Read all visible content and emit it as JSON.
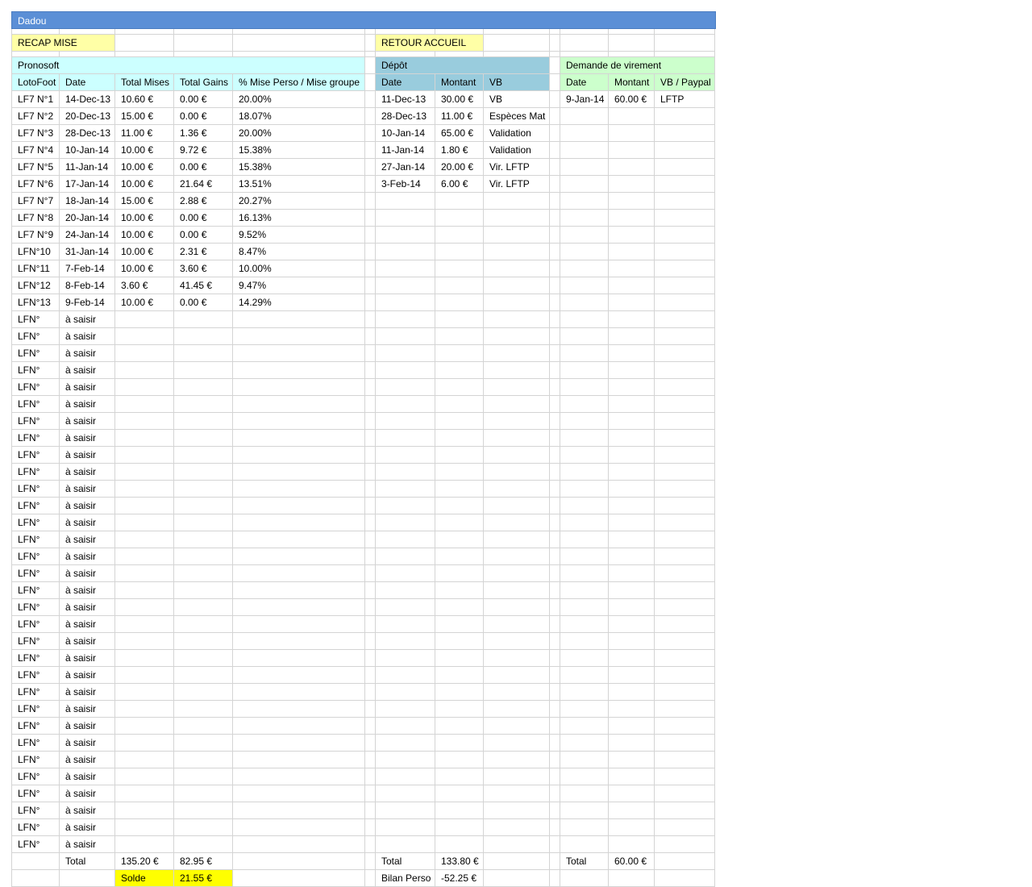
{
  "title": "Dadou",
  "links": {
    "recap": "RECAP MISE",
    "retour": "RETOUR ACCUEIL"
  },
  "pronosoft": {
    "title": "Pronosoft",
    "headers": [
      "LotoFoot",
      "Date",
      "Total Mises",
      "Total Gains",
      "% Mise Perso / Mise groupe"
    ],
    "rows": [
      [
        "LF7 N°1",
        "14-Dec-13",
        "10.60 €",
        "0.00 €",
        "20.00%"
      ],
      [
        "LF7 N°2",
        "20-Dec-13",
        "15.00 €",
        "0.00 €",
        "18.07%"
      ],
      [
        "LF7 N°3",
        "28-Dec-13",
        "11.00 €",
        "1.36 €",
        "20.00%"
      ],
      [
        "LF7 N°4",
        "10-Jan-14",
        "10.00 €",
        "9.72 €",
        "15.38%"
      ],
      [
        "LF7 N°5",
        "11-Jan-14",
        "10.00 €",
        "0.00 €",
        "15.38%"
      ],
      [
        "LF7 N°6",
        "17-Jan-14",
        "10.00 €",
        "21.64 €",
        "13.51%"
      ],
      [
        "LF7 N°7",
        "18-Jan-14",
        "15.00 €",
        "2.88 €",
        "20.27%"
      ],
      [
        "LF7 N°8",
        "20-Jan-14",
        "10.00 €",
        "0.00 €",
        "16.13%"
      ],
      [
        "LF7 N°9",
        "24-Jan-14",
        "10.00 €",
        "0.00 €",
        "9.52%"
      ],
      [
        "LFN°10",
        "31-Jan-14",
        "10.00 €",
        "2.31 €",
        "8.47%"
      ],
      [
        "LFN°11",
        "7-Feb-14",
        "10.00 €",
        "3.60 €",
        "10.00%"
      ],
      [
        "LFN°12",
        "8-Feb-14",
        "3.60 €",
        "41.45 €",
        "9.47%"
      ],
      [
        "LFN°13",
        "9-Feb-14",
        "10.00 €",
        "0.00 €",
        "14.29%"
      ],
      [
        "LFN°",
        "à saisir",
        "",
        "",
        ""
      ],
      [
        "LFN°",
        "à saisir",
        "",
        "",
        ""
      ],
      [
        "LFN°",
        "à saisir",
        "",
        "",
        ""
      ],
      [
        "LFN°",
        "à saisir",
        "",
        "",
        ""
      ],
      [
        "LFN°",
        "à saisir",
        "",
        "",
        ""
      ],
      [
        "LFN°",
        "à saisir",
        "",
        "",
        ""
      ],
      [
        "LFN°",
        "à saisir",
        "",
        "",
        ""
      ],
      [
        "LFN°",
        "à saisir",
        "",
        "",
        ""
      ],
      [
        "LFN°",
        "à saisir",
        "",
        "",
        ""
      ],
      [
        "LFN°",
        "à saisir",
        "",
        "",
        ""
      ],
      [
        "LFN°",
        "à saisir",
        "",
        "",
        ""
      ],
      [
        "LFN°",
        "à saisir",
        "",
        "",
        ""
      ],
      [
        "LFN°",
        "à saisir",
        "",
        "",
        ""
      ],
      [
        "LFN°",
        "à saisir",
        "",
        "",
        ""
      ],
      [
        "LFN°",
        "à saisir",
        "",
        "",
        ""
      ],
      [
        "LFN°",
        "à saisir",
        "",
        "",
        ""
      ],
      [
        "LFN°",
        "à saisir",
        "",
        "",
        ""
      ],
      [
        "LFN°",
        "à saisir",
        "",
        "",
        ""
      ],
      [
        "LFN°",
        "à saisir",
        "",
        "",
        ""
      ],
      [
        "LFN°",
        "à saisir",
        "",
        "",
        ""
      ],
      [
        "LFN°",
        "à saisir",
        "",
        "",
        ""
      ],
      [
        "LFN°",
        "à saisir",
        "",
        "",
        ""
      ],
      [
        "LFN°",
        "à saisir",
        "",
        "",
        ""
      ],
      [
        "LFN°",
        "à saisir",
        "",
        "",
        ""
      ],
      [
        "LFN°",
        "à saisir",
        "",
        "",
        ""
      ],
      [
        "LFN°",
        "à saisir",
        "",
        "",
        ""
      ],
      [
        "LFN°",
        "à saisir",
        "",
        "",
        ""
      ],
      [
        "LFN°",
        "à saisir",
        "",
        "",
        ""
      ],
      [
        "LFN°",
        "à saisir",
        "",
        "",
        ""
      ],
      [
        "LFN°",
        "à saisir",
        "",
        "",
        ""
      ],
      [
        "LFN°",
        "à saisir",
        "",
        "",
        ""
      ],
      [
        "LFN°",
        "à saisir",
        "",
        "",
        ""
      ]
    ],
    "total_label": "Total",
    "total_mises": "135.20 €",
    "total_gains": "82.95 €",
    "solde_label": "Solde",
    "solde_value": "21.55 €"
  },
  "depot": {
    "title": "Dépôt",
    "headers": [
      "Date",
      "Montant",
      "VB"
    ],
    "rows": [
      [
        "11-Dec-13",
        "30.00 €",
        "VB"
      ],
      [
        "28-Dec-13",
        "11.00 €",
        "Espèces Mat"
      ],
      [
        "10-Jan-14",
        "65.00 €",
        "Validation"
      ],
      [
        "11-Jan-14",
        "1.80 €",
        "Validation"
      ],
      [
        "27-Jan-14",
        "20.00 €",
        "Vir. LFTP"
      ],
      [
        "3-Feb-14",
        "6.00 €",
        "Vir. LFTP"
      ]
    ],
    "total_label": "Total",
    "total_value": "133.80 €",
    "bilan_label": "Bilan Perso",
    "bilan_value": "-52.25 €"
  },
  "virement": {
    "title": "Demande de virement",
    "headers": [
      "Date",
      "Montant",
      "VB / Paypal"
    ],
    "rows": [
      [
        "9-Jan-14",
        "60.00 €",
        "LFTP"
      ]
    ],
    "total_label": "Total",
    "total_value": "60.00 €"
  }
}
